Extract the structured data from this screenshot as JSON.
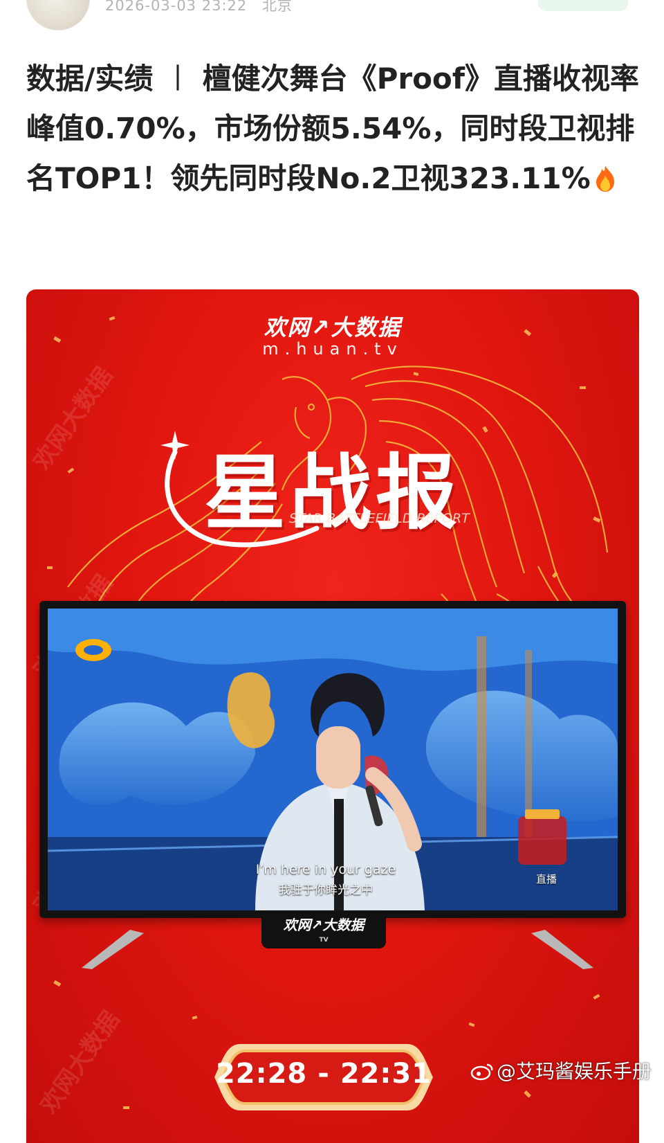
{
  "post": {
    "timestamp": "2026-03-03 23:22",
    "location": "北京",
    "text": "数据/实绩 ︱ 檀健次舞台《Proof》直播收视率峰值0.70%，市场份额5.54%，同时段卫视排名TOP1！领先同时段No.2卫视323.11%",
    "emoji": "fire-emoji"
  },
  "poster": {
    "brand_title": "欢网↗大数据",
    "brand_url": "m.huan.tv",
    "main_title": "星战报",
    "subtitle": "STAR BATTLEFIELD REPORT",
    "tv_subtitle_en": "I’m here in your gaze",
    "tv_subtitle_zh": "我驻于你眸光之中",
    "tv_live_label": "直播",
    "tv_badge": "欢网↗大数据",
    "tv_badge_small": "TV",
    "time_range": "22:28 - 22:31",
    "side_watermark": "欢网大数据",
    "colors": {
      "poster_red": "#e0160f",
      "gold": "#f2b23a",
      "tv_blue": "#2f7fe0"
    }
  },
  "watermark": {
    "text": "@艾玛酱娱乐手册",
    "icon": "weibo-icon"
  }
}
